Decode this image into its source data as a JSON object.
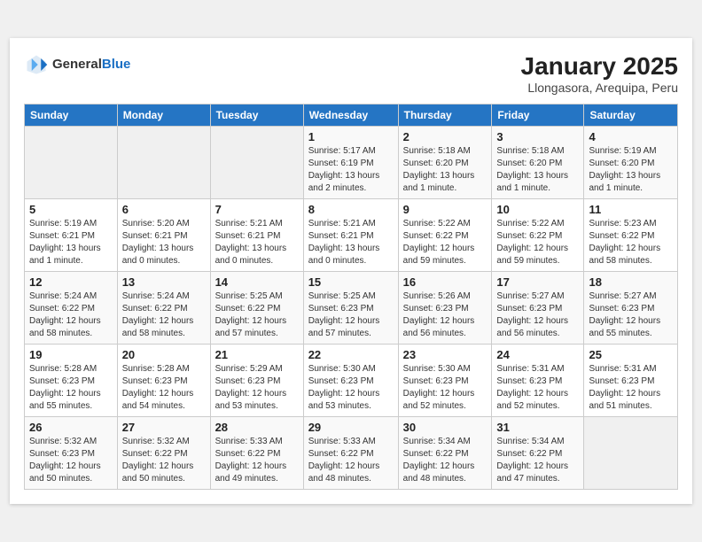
{
  "header": {
    "logo_general": "General",
    "logo_blue": "Blue",
    "month": "January 2025",
    "location": "Llongasora, Arequipa, Peru"
  },
  "weekdays": [
    "Sunday",
    "Monday",
    "Tuesday",
    "Wednesday",
    "Thursday",
    "Friday",
    "Saturday"
  ],
  "weeks": [
    [
      {
        "day": "",
        "info": ""
      },
      {
        "day": "",
        "info": ""
      },
      {
        "day": "",
        "info": ""
      },
      {
        "day": "1",
        "info": "Sunrise: 5:17 AM\nSunset: 6:19 PM\nDaylight: 13 hours\nand 2 minutes."
      },
      {
        "day": "2",
        "info": "Sunrise: 5:18 AM\nSunset: 6:20 PM\nDaylight: 13 hours\nand 1 minute."
      },
      {
        "day": "3",
        "info": "Sunrise: 5:18 AM\nSunset: 6:20 PM\nDaylight: 13 hours\nand 1 minute."
      },
      {
        "day": "4",
        "info": "Sunrise: 5:19 AM\nSunset: 6:20 PM\nDaylight: 13 hours\nand 1 minute."
      }
    ],
    [
      {
        "day": "5",
        "info": "Sunrise: 5:19 AM\nSunset: 6:21 PM\nDaylight: 13 hours\nand 1 minute."
      },
      {
        "day": "6",
        "info": "Sunrise: 5:20 AM\nSunset: 6:21 PM\nDaylight: 13 hours\nand 0 minutes."
      },
      {
        "day": "7",
        "info": "Sunrise: 5:21 AM\nSunset: 6:21 PM\nDaylight: 13 hours\nand 0 minutes."
      },
      {
        "day": "8",
        "info": "Sunrise: 5:21 AM\nSunset: 6:21 PM\nDaylight: 13 hours\nand 0 minutes."
      },
      {
        "day": "9",
        "info": "Sunrise: 5:22 AM\nSunset: 6:22 PM\nDaylight: 12 hours\nand 59 minutes."
      },
      {
        "day": "10",
        "info": "Sunrise: 5:22 AM\nSunset: 6:22 PM\nDaylight: 12 hours\nand 59 minutes."
      },
      {
        "day": "11",
        "info": "Sunrise: 5:23 AM\nSunset: 6:22 PM\nDaylight: 12 hours\nand 58 minutes."
      }
    ],
    [
      {
        "day": "12",
        "info": "Sunrise: 5:24 AM\nSunset: 6:22 PM\nDaylight: 12 hours\nand 58 minutes."
      },
      {
        "day": "13",
        "info": "Sunrise: 5:24 AM\nSunset: 6:22 PM\nDaylight: 12 hours\nand 58 minutes."
      },
      {
        "day": "14",
        "info": "Sunrise: 5:25 AM\nSunset: 6:22 PM\nDaylight: 12 hours\nand 57 minutes."
      },
      {
        "day": "15",
        "info": "Sunrise: 5:25 AM\nSunset: 6:23 PM\nDaylight: 12 hours\nand 57 minutes."
      },
      {
        "day": "16",
        "info": "Sunrise: 5:26 AM\nSunset: 6:23 PM\nDaylight: 12 hours\nand 56 minutes."
      },
      {
        "day": "17",
        "info": "Sunrise: 5:27 AM\nSunset: 6:23 PM\nDaylight: 12 hours\nand 56 minutes."
      },
      {
        "day": "18",
        "info": "Sunrise: 5:27 AM\nSunset: 6:23 PM\nDaylight: 12 hours\nand 55 minutes."
      }
    ],
    [
      {
        "day": "19",
        "info": "Sunrise: 5:28 AM\nSunset: 6:23 PM\nDaylight: 12 hours\nand 55 minutes."
      },
      {
        "day": "20",
        "info": "Sunrise: 5:28 AM\nSunset: 6:23 PM\nDaylight: 12 hours\nand 54 minutes."
      },
      {
        "day": "21",
        "info": "Sunrise: 5:29 AM\nSunset: 6:23 PM\nDaylight: 12 hours\nand 53 minutes."
      },
      {
        "day": "22",
        "info": "Sunrise: 5:30 AM\nSunset: 6:23 PM\nDaylight: 12 hours\nand 53 minutes."
      },
      {
        "day": "23",
        "info": "Sunrise: 5:30 AM\nSunset: 6:23 PM\nDaylight: 12 hours\nand 52 minutes."
      },
      {
        "day": "24",
        "info": "Sunrise: 5:31 AM\nSunset: 6:23 PM\nDaylight: 12 hours\nand 52 minutes."
      },
      {
        "day": "25",
        "info": "Sunrise: 5:31 AM\nSunset: 6:23 PM\nDaylight: 12 hours\nand 51 minutes."
      }
    ],
    [
      {
        "day": "26",
        "info": "Sunrise: 5:32 AM\nSunset: 6:23 PM\nDaylight: 12 hours\nand 50 minutes."
      },
      {
        "day": "27",
        "info": "Sunrise: 5:32 AM\nSunset: 6:22 PM\nDaylight: 12 hours\nand 50 minutes."
      },
      {
        "day": "28",
        "info": "Sunrise: 5:33 AM\nSunset: 6:22 PM\nDaylight: 12 hours\nand 49 minutes."
      },
      {
        "day": "29",
        "info": "Sunrise: 5:33 AM\nSunset: 6:22 PM\nDaylight: 12 hours\nand 48 minutes."
      },
      {
        "day": "30",
        "info": "Sunrise: 5:34 AM\nSunset: 6:22 PM\nDaylight: 12 hours\nand 48 minutes."
      },
      {
        "day": "31",
        "info": "Sunrise: 5:34 AM\nSunset: 6:22 PM\nDaylight: 12 hours\nand 47 minutes."
      },
      {
        "day": "",
        "info": ""
      }
    ]
  ]
}
